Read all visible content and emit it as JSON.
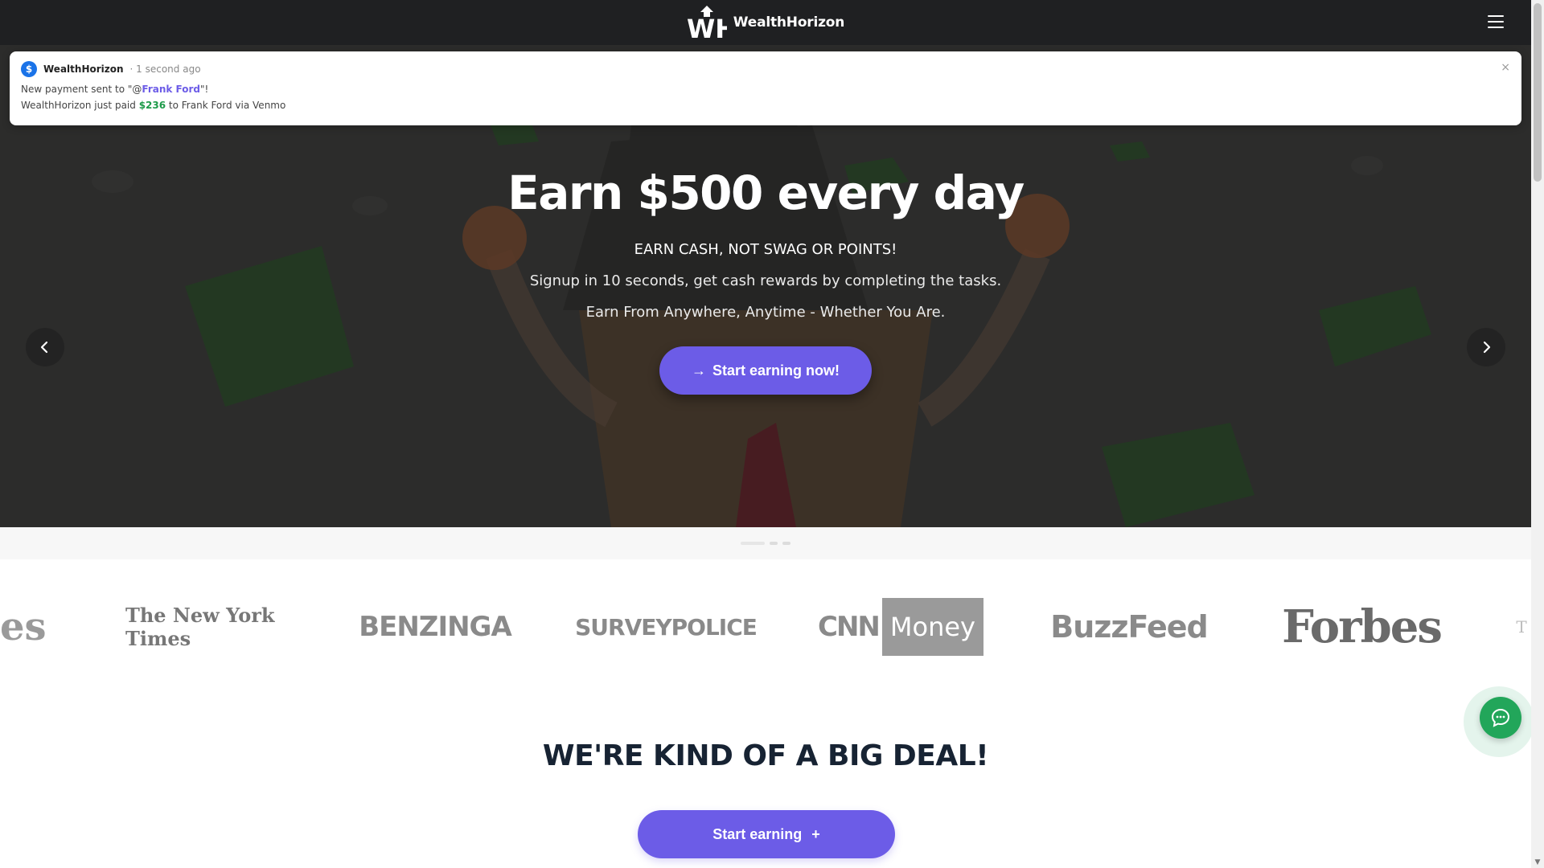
{
  "brand": {
    "name": "WealthHorizon",
    "logo_initials": "WH"
  },
  "notification": {
    "badge": "$",
    "app": "WealthHorizon",
    "time": "· 1 second ago",
    "line1_prefix": "New payment sent to \"@",
    "line1_name": "Frank Ford",
    "line1_suffix": "\"!",
    "line2_prefix": "WealthHorizon just paid ",
    "line2_amount": "$236",
    "line2_suffix": " to Frank Ford via Venmo",
    "close": "×"
  },
  "hero": {
    "title": "Earn $500 every day",
    "tagline": "EARN CASH, NOT SWAG OR POINTS!",
    "subtitle1": "Signup in 10 seconds, get cash rewards by completing the tasks.",
    "subtitle2": "Earn From Anywhere, Anytime - Whether You Are.",
    "cta_arrow": "→",
    "cta_label": "Start earning now!"
  },
  "press": {
    "partial_left": "es",
    "nyt": "The New York Times",
    "benzinga": "BENZINGA",
    "surveypolice": "SURVEYPOLICE",
    "cnn": "CNN",
    "money": "Money",
    "buzzfeed": "BuzzFeed",
    "forbes": "Forbes",
    "partial_right": "T"
  },
  "section": {
    "title": "WE'RE KIND OF A BIG DEAL!",
    "button_label": "Start earning",
    "button_icon": "+"
  },
  "colors": {
    "accent": "#6c5ce7",
    "navbar": "#1f2022",
    "chat": "#22a65a",
    "money_green": "#1e9b4a"
  },
  "icons": {
    "menu": "hamburger-menu-icon",
    "prev": "chevron-left-icon",
    "next": "chevron-right-icon",
    "chat": "chat-bubble-icon",
    "close": "close-icon"
  }
}
